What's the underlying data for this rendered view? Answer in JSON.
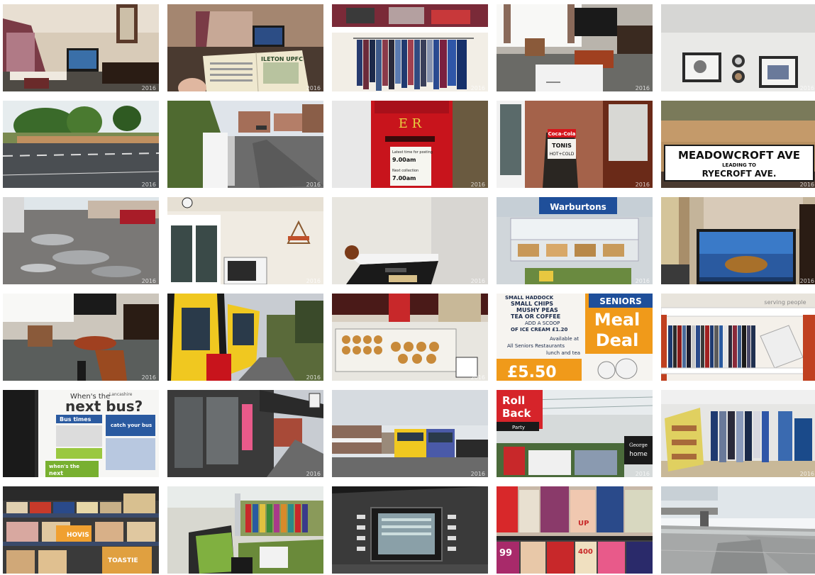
{
  "stamp": "2016",
  "texts": {
    "book_title": "ILETON UPFC",
    "postbox_cipher": "E R",
    "postbox_notice_1": "Latest time for posting",
    "postbox_notice_2": "9.00am",
    "postbox_notice_3": "Next collection",
    "postbox_notice_4": "7.00am",
    "cafe_board_brand": "Coca-Cola",
    "cafe_board_1": "TONIS",
    "cafe_board_2": "HOT+COLD",
    "street_sign_1": "MEADOWCROFT AVE",
    "street_sign_2": "LEADING TO",
    "street_sign_3": "RYECROFT AVE.",
    "bakery_brand": "Warburtons",
    "shop_sign": "serving people",
    "meal_1": "SMALL HADDOCK",
    "meal_2": "SMALL CHIPS",
    "meal_3": "MUSHY PEAS",
    "meal_4": "TEA OR COFFEE",
    "meal_5": "ADD A SCOOP",
    "meal_6": "OF ICE CREAM £1.20",
    "meal_7": "Available at",
    "meal_8": "All Seniors Restaurants",
    "meal_9": "lunch and tea",
    "meal_seniors": "SENIORS",
    "meal_big_1": "Meal",
    "meal_big_2": "Deal",
    "meal_price": "£5.50",
    "bus_1": "When's the",
    "bus_2": "next bus?",
    "bus_3": "Bus times",
    "bus_4": "catch your bus",
    "bus_5": "when's the",
    "bus_6": "next",
    "bus_7": "Lancashire",
    "rollback_1": "Roll",
    "rollback_2": "Back",
    "rollback_3": "Party",
    "george_1": "George",
    "george_2": "home",
    "bread_1": "HOVIS",
    "bread_2": "TOASTIE",
    "mag_1": "UP",
    "mag_2": "99",
    "mag_3": "400"
  }
}
